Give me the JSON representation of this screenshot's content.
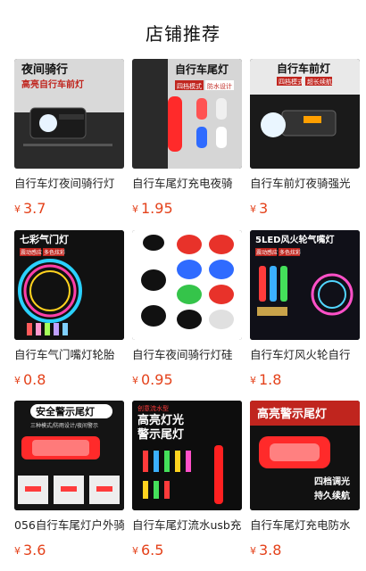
{
  "section_title": "店铺推荐",
  "currency_symbol": "¥",
  "products": [
    {
      "name": "自行车灯夜间骑行灯",
      "price": "3.7",
      "image_text": [
        "夜间骑行",
        "高亮自行车前灯"
      ]
    },
    {
      "name": "自行车尾灯充电夜骑",
      "price": "1.95",
      "image_text": [
        "自行车尾灯",
        "四档模式",
        "防水设计"
      ]
    },
    {
      "name": "自行车前灯夜骑强光",
      "price": "3",
      "image_text": [
        "自行车前灯",
        "四档模式",
        "超长续航"
      ]
    },
    {
      "name": "自行车气门嘴灯轮胎",
      "price": "0.8",
      "image_text": [
        "七彩气门灯",
        "震动感应",
        "多色炫彩"
      ]
    },
    {
      "name": "自行车夜间骑行灯硅",
      "price": "0.95",
      "image_text": []
    },
    {
      "name": "自行车灯风火轮自行",
      "price": "1.8",
      "image_text": [
        "5LED风火轮气嘴灯",
        "震动感应",
        "多色炫彩"
      ]
    },
    {
      "name": "056自行车尾灯户外骑",
      "price": "3.6",
      "image_text": [
        "安全警示尾灯",
        "三种模式/防雨设计/夜间警示"
      ]
    },
    {
      "name": "自行车尾灯流水usb充",
      "price": "6.5",
      "image_text": [
        "创意流水型",
        "高亮灯光",
        "警示尾灯"
      ]
    },
    {
      "name": "自行车尾灯充电防水",
      "price": "3.8",
      "image_text": [
        "高亮警示尾灯",
        "四档调光",
        "持久续航"
      ]
    }
  ],
  "colors": {
    "price": "#e4421b",
    "title": "#111111"
  }
}
